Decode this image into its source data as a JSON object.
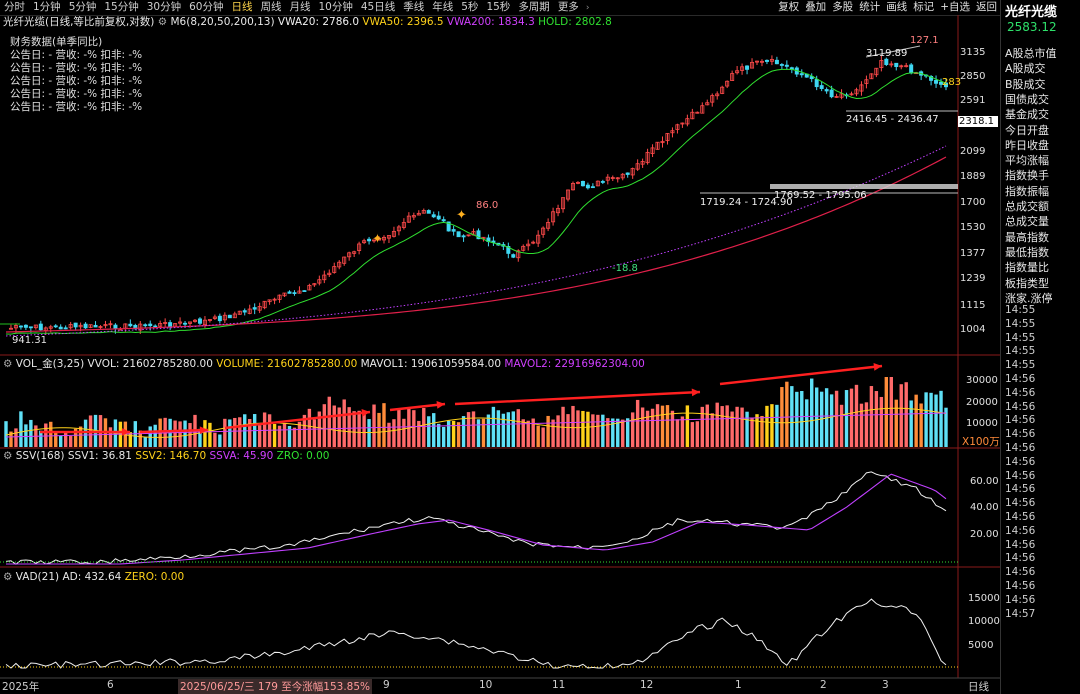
{
  "periods": [
    "分时",
    "1分钟",
    "5分钟",
    "15分钟",
    "30分钟",
    "60分钟",
    "日线",
    "周线",
    "月线",
    "10分钟",
    "45日线",
    "季线",
    "年线",
    "5秒",
    "15秒",
    "多周期",
    "更多"
  ],
  "active_period": "日线",
  "tools": [
    "复权",
    "叠加",
    "多股",
    "统计",
    "画线",
    "标记",
    "+自选",
    "返回"
  ],
  "side": {
    "title": "光纤光缆",
    "price": "2583.12",
    "menu": [
      "A股总市值",
      "A股成交",
      "B股成交",
      "国债成交",
      "基金成交",
      "今日开盘",
      "昨日收盘",
      "平均涨幅",
      "指数换手",
      "指数振幅",
      "总成交额",
      "总成交量",
      "最高指数",
      "最低指数",
      "指数量比",
      "板指类型",
      "涨家.涨停"
    ],
    "times": [
      "14:55",
      "14:55",
      "14:55",
      "14:55",
      "14:55",
      "14:56",
      "14:56",
      "14:56",
      "14:56",
      "14:56",
      "14:56",
      "14:56",
      "14:56",
      "14:56",
      "14:56",
      "14:56",
      "14:56",
      "14:56",
      "14:56",
      "14:56",
      "14:56",
      "14:56",
      "14:57"
    ]
  },
  "main": {
    "title": "光纤光缆(日线,等比前复权,对数)",
    "ma_label": "M6(8,20,50,200,13)",
    "vwa20": "VWA20: 2786.0",
    "vwa50": "VWA50: 2396.5",
    "vwa200": "VWA200: 1834.3",
    "hold": "HOLD: 2802.8",
    "fin_title": "财务数据(单季同比)",
    "fin_rows": [
      "公告日: -    营收: -%    扣非: -%",
      "公告日: -    营收: -%    扣非: -%",
      "公告日: -    营收: -%    扣非: -%",
      "公告日: -    营收: -%    扣非: -%",
      "公告日: -    营收: -%    扣非: -%"
    ],
    "y_ticks": [
      "3135",
      "2850",
      "2591",
      "2318.1",
      "2099",
      "1889",
      "1700",
      "1530",
      "1377",
      "1239",
      "1115",
      "1004"
    ],
    "annotations": {
      "low_start": "941.31",
      "peak_86": "86.0",
      "low_188": "-18.8",
      "high_1271": "127.1",
      "high_311989": "3119.89",
      "cut_283": "283",
      "zone1": "1719.24 - 1724.90",
      "zone2": "1769.52 - 1795.06",
      "zone3": "2416.45 - 2436.47"
    }
  },
  "vol": {
    "label": "VOL_金(3,25)",
    "vvol": "VVOL: 21602785280.00",
    "volume": "VOLUME: 21602785280.00",
    "mavol1": "MAVOL1: 19061059584.00",
    "mavol2": "MAVOL2: 22916962304.00",
    "y_ticks": [
      "30000",
      "20000",
      "10000"
    ],
    "unit": "X100万"
  },
  "ssv": {
    "label": "SSV(168)",
    "ssv1": "SSV1: 36.81",
    "ssv2": "SSV2: 146.70",
    "ssva": "SSVA: 45.90",
    "zro": "ZRO: 0.00",
    "y_ticks": [
      "60.00",
      "40.00",
      "20.00"
    ]
  },
  "vad": {
    "label": "VAD(21)",
    "ad": "AD: 432.64",
    "zero": "ZERO: 0.00",
    "y_ticks": [
      "15000",
      "10000",
      "5000"
    ]
  },
  "xaxis": {
    "labels": [
      "2025年",
      "6",
      "2025/06/25/三 179 至今涨幅153.85%",
      "9",
      "10",
      "11",
      "12",
      "1",
      "2",
      "3"
    ],
    "period_btn": "日线"
  },
  "colors": {
    "up": "#ff4a4a",
    "down": "#3fd7f2",
    "ma": "#20c020",
    "vwa200": "#e0204a",
    "vwa50": "#c040ff",
    "hold": "#30e030"
  }
}
